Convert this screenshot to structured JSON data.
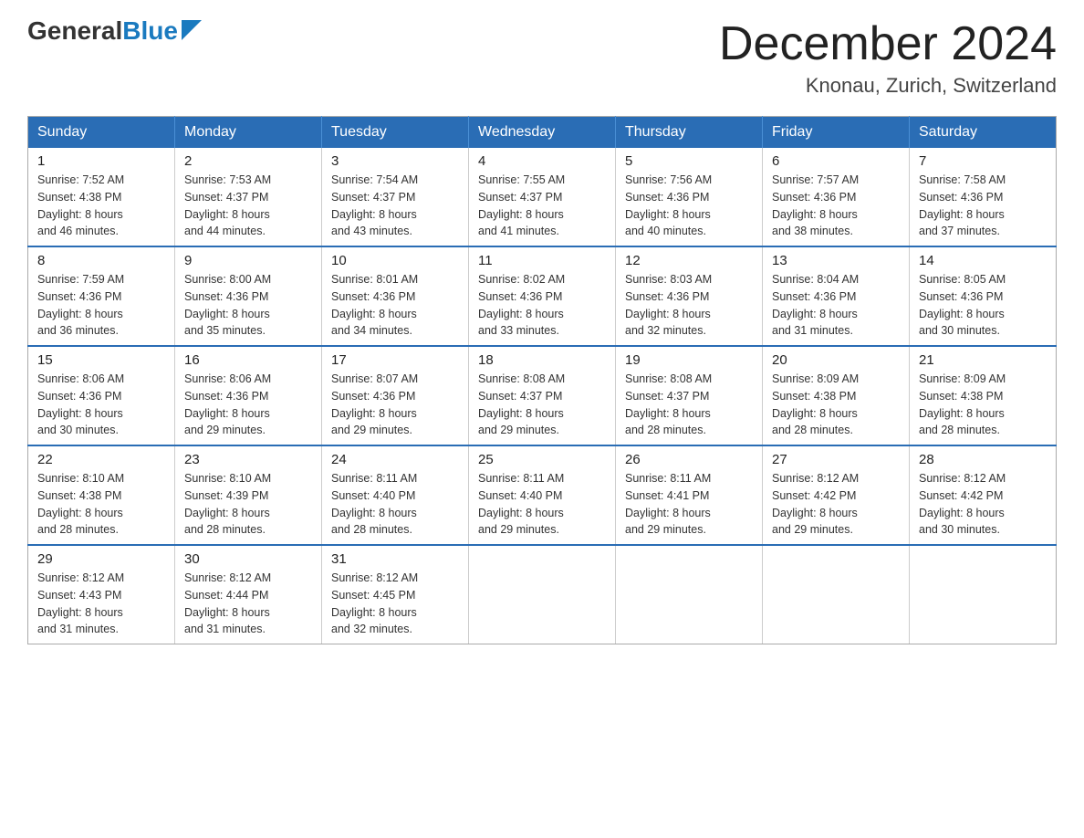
{
  "header": {
    "logo_general": "General",
    "logo_blue": "Blue",
    "month_title": "December 2024",
    "location": "Knonau, Zurich, Switzerland"
  },
  "days_of_week": [
    "Sunday",
    "Monday",
    "Tuesday",
    "Wednesday",
    "Thursday",
    "Friday",
    "Saturday"
  ],
  "weeks": [
    [
      {
        "day": "1",
        "sunrise": "7:52 AM",
        "sunset": "4:38 PM",
        "daylight": "8 hours and 46 minutes."
      },
      {
        "day": "2",
        "sunrise": "7:53 AM",
        "sunset": "4:37 PM",
        "daylight": "8 hours and 44 minutes."
      },
      {
        "day": "3",
        "sunrise": "7:54 AM",
        "sunset": "4:37 PM",
        "daylight": "8 hours and 43 minutes."
      },
      {
        "day": "4",
        "sunrise": "7:55 AM",
        "sunset": "4:37 PM",
        "daylight": "8 hours and 41 minutes."
      },
      {
        "day": "5",
        "sunrise": "7:56 AM",
        "sunset": "4:36 PM",
        "daylight": "8 hours and 40 minutes."
      },
      {
        "day": "6",
        "sunrise": "7:57 AM",
        "sunset": "4:36 PM",
        "daylight": "8 hours and 38 minutes."
      },
      {
        "day": "7",
        "sunrise": "7:58 AM",
        "sunset": "4:36 PM",
        "daylight": "8 hours and 37 minutes."
      }
    ],
    [
      {
        "day": "8",
        "sunrise": "7:59 AM",
        "sunset": "4:36 PM",
        "daylight": "8 hours and 36 minutes."
      },
      {
        "day": "9",
        "sunrise": "8:00 AM",
        "sunset": "4:36 PM",
        "daylight": "8 hours and 35 minutes."
      },
      {
        "day": "10",
        "sunrise": "8:01 AM",
        "sunset": "4:36 PM",
        "daylight": "8 hours and 34 minutes."
      },
      {
        "day": "11",
        "sunrise": "8:02 AM",
        "sunset": "4:36 PM",
        "daylight": "8 hours and 33 minutes."
      },
      {
        "day": "12",
        "sunrise": "8:03 AM",
        "sunset": "4:36 PM",
        "daylight": "8 hours and 32 minutes."
      },
      {
        "day": "13",
        "sunrise": "8:04 AM",
        "sunset": "4:36 PM",
        "daylight": "8 hours and 31 minutes."
      },
      {
        "day": "14",
        "sunrise": "8:05 AM",
        "sunset": "4:36 PM",
        "daylight": "8 hours and 30 minutes."
      }
    ],
    [
      {
        "day": "15",
        "sunrise": "8:06 AM",
        "sunset": "4:36 PM",
        "daylight": "8 hours and 30 minutes."
      },
      {
        "day": "16",
        "sunrise": "8:06 AM",
        "sunset": "4:36 PM",
        "daylight": "8 hours and 29 minutes."
      },
      {
        "day": "17",
        "sunrise": "8:07 AM",
        "sunset": "4:36 PM",
        "daylight": "8 hours and 29 minutes."
      },
      {
        "day": "18",
        "sunrise": "8:08 AM",
        "sunset": "4:37 PM",
        "daylight": "8 hours and 29 minutes."
      },
      {
        "day": "19",
        "sunrise": "8:08 AM",
        "sunset": "4:37 PM",
        "daylight": "8 hours and 28 minutes."
      },
      {
        "day": "20",
        "sunrise": "8:09 AM",
        "sunset": "4:38 PM",
        "daylight": "8 hours and 28 minutes."
      },
      {
        "day": "21",
        "sunrise": "8:09 AM",
        "sunset": "4:38 PM",
        "daylight": "8 hours and 28 minutes."
      }
    ],
    [
      {
        "day": "22",
        "sunrise": "8:10 AM",
        "sunset": "4:38 PM",
        "daylight": "8 hours and 28 minutes."
      },
      {
        "day": "23",
        "sunrise": "8:10 AM",
        "sunset": "4:39 PM",
        "daylight": "8 hours and 28 minutes."
      },
      {
        "day": "24",
        "sunrise": "8:11 AM",
        "sunset": "4:40 PM",
        "daylight": "8 hours and 28 minutes."
      },
      {
        "day": "25",
        "sunrise": "8:11 AM",
        "sunset": "4:40 PM",
        "daylight": "8 hours and 29 minutes."
      },
      {
        "day": "26",
        "sunrise": "8:11 AM",
        "sunset": "4:41 PM",
        "daylight": "8 hours and 29 minutes."
      },
      {
        "day": "27",
        "sunrise": "8:12 AM",
        "sunset": "4:42 PM",
        "daylight": "8 hours and 29 minutes."
      },
      {
        "day": "28",
        "sunrise": "8:12 AM",
        "sunset": "4:42 PM",
        "daylight": "8 hours and 30 minutes."
      }
    ],
    [
      {
        "day": "29",
        "sunrise": "8:12 AM",
        "sunset": "4:43 PM",
        "daylight": "8 hours and 31 minutes."
      },
      {
        "day": "30",
        "sunrise": "8:12 AM",
        "sunset": "4:44 PM",
        "daylight": "8 hours and 31 minutes."
      },
      {
        "day": "31",
        "sunrise": "8:12 AM",
        "sunset": "4:45 PM",
        "daylight": "8 hours and 32 minutes."
      },
      null,
      null,
      null,
      null
    ]
  ],
  "labels": {
    "sunrise": "Sunrise:",
    "sunset": "Sunset:",
    "daylight": "Daylight:"
  }
}
